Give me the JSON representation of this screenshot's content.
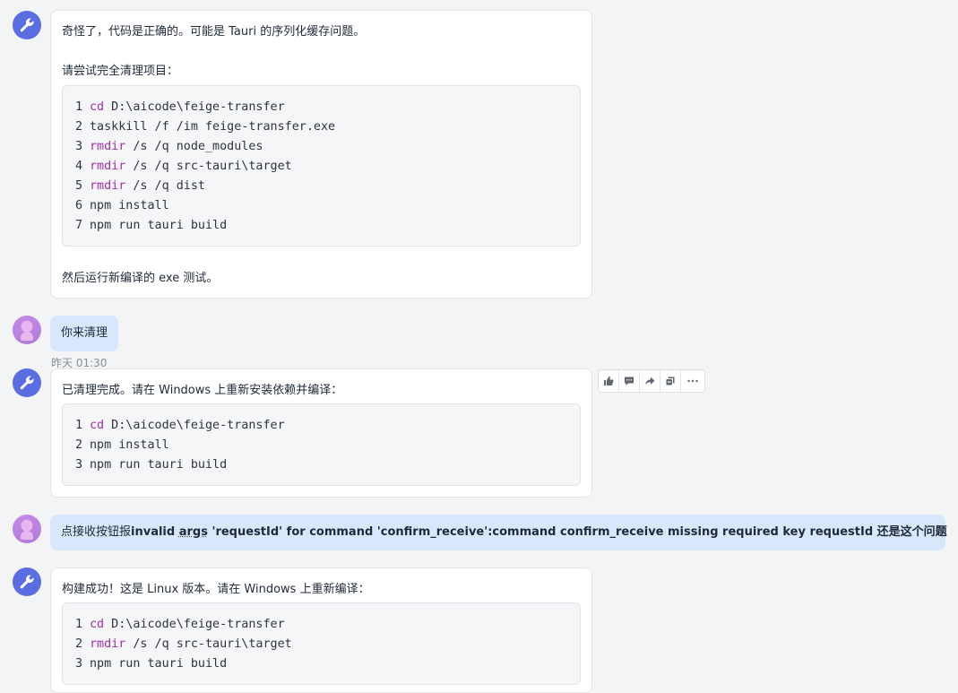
{
  "messages": [
    {
      "role": "assistant",
      "intro": "奇怪了，代码是正确的。可能是 Tauri 的序列化缓存问题。",
      "lead": "请尝试完全清理项目：",
      "code": [
        {
          "n": "1",
          "kw": "cd",
          "rest": " D:\\aicode\\feige-transfer"
        },
        {
          "n": "2",
          "kw": "",
          "rest": "taskkill /f /im feige-transfer.exe"
        },
        {
          "n": "3",
          "kw": "rmdir",
          "rest": " /s /q node_modules"
        },
        {
          "n": "4",
          "kw": "rmdir",
          "rest": " /s /q src-tauri\\target"
        },
        {
          "n": "5",
          "kw": "rmdir",
          "rest": " /s /q dist"
        },
        {
          "n": "6",
          "kw": "",
          "rest": "npm install"
        },
        {
          "n": "7",
          "kw": "",
          "rest": "npm run tauri build"
        }
      ],
      "outro": "然后运行新编译的 exe 测试。"
    },
    {
      "role": "user",
      "text": "你来清理",
      "timestamp": "昨天 01:30"
    },
    {
      "role": "assistant",
      "intro": "已清理完成。请在 Windows 上重新安装依赖并编译：",
      "code": [
        {
          "n": "1",
          "kw": "cd",
          "rest": " D:\\aicode\\feige-transfer"
        },
        {
          "n": "2",
          "kw": "",
          "rest": "npm install"
        },
        {
          "n": "3",
          "kw": "",
          "rest": "npm run tauri build"
        }
      ],
      "actions": [
        "thumb-up-icon",
        "comment-icon",
        "share-icon",
        "copy-icon",
        "more-icon"
      ]
    },
    {
      "role": "user",
      "text_prefix": "点接收按钮报",
      "text_bold_1": "invalid ",
      "text_dotted": "args",
      "text_bold_2": " 'requestId' for command 'confirm_receive':command confirm_receive missing required key requestId",
      "text_suffix": " 还是这个问题"
    },
    {
      "role": "assistant",
      "intro": "构建成功！这是 Linux 版本。请在 Windows 上重新编译：",
      "code": [
        {
          "n": "1",
          "kw": "cd",
          "rest": " D:\\aicode\\feige-transfer"
        },
        {
          "n": "2",
          "kw": "rmdir",
          "rest": " /s /q src-tauri\\target"
        },
        {
          "n": "3",
          "kw": "",
          "rest": "npm run tauri build"
        }
      ]
    }
  ],
  "colors": {
    "bot_avatar": "#5b6ee1",
    "user_bubble": "#d9e7fc",
    "keyword": "#a12ea8"
  }
}
